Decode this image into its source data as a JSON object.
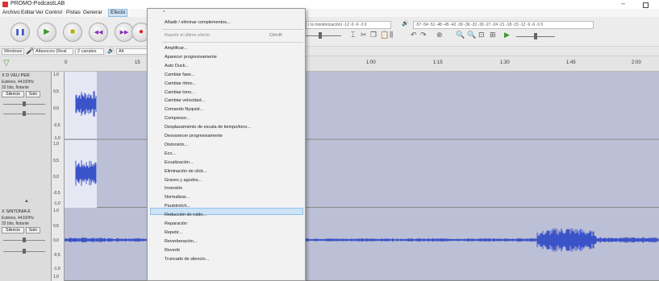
{
  "window": {
    "title": "PROMO-PodcastLAB",
    "min_glyph": "–"
  },
  "menubar": {
    "items": [
      "Archivo",
      "Editar",
      "Ver",
      "Control",
      "Pistas",
      "Generar",
      "Efecto"
    ]
  },
  "toolbar": {
    "pause_glyph": "❚❚",
    "play_glyph": "▶",
    "stop_glyph": "■",
    "skip_start_glyph": "◀◀",
    "skip_end_glyph": "▶▶",
    "record_glyph": "●",
    "monitor_ruler": "r la monitorización) -12 -9 -6 -3 0",
    "playback_ruler": "-57 -54 -51 -48 -45 -42 -39 -36 -33 -30 -27 -24 -21 -18 -15 -12 -9 -6 -3 0",
    "speaker_glyph": "🔊"
  },
  "devicebar": {
    "host": "Windows",
    "input": "Altavoces (Real",
    "channels": "2 canales",
    "output": "Alt"
  },
  "timeline": {
    "ticks": [
      "0",
      "15",
      "1:00",
      "1:15",
      "1:30",
      "1:45",
      "2:00"
    ]
  },
  "tracks": [
    {
      "name": "X  D VEU PER",
      "info1": "Estéreo, 44100Hz",
      "info2": "32 bits, flotante",
      "mute_label": "Silencio",
      "solo_label": "Solo",
      "scale": [
        "1,0",
        "0,5",
        "0,0",
        "-0,5",
        "-1,0",
        "1,0",
        "0,5",
        "0,0",
        "-0,5",
        "-1,0"
      ]
    },
    {
      "name": "X  SINTONIA E",
      "info1": "Estéreo, 44100Hz",
      "info2": "32 bits, flotante",
      "mute_label": "Silencio",
      "solo_label": "Solo",
      "scale": [
        "1,0",
        "0,5",
        "0,0",
        "-0,5",
        "-1,0",
        "1,0"
      ]
    }
  ],
  "effect_menu": {
    "top_arrow": "^",
    "add_remove": "Añadir / eliminar complementos...",
    "repeat_last": "Repetir el último efecto",
    "repeat_shortcut": "Ctrl+R",
    "items": [
      "Amplificar...",
      "Aparecer progresivamente",
      "Auto Duck...",
      "Cambiar fase...",
      "Cambiar ritmo...",
      "Cambiar tono...",
      "Cambiar velocidad...",
      "Comando Nyquist...",
      "Compresor...",
      "Desplazamiento de escala de tiempo/tono...",
      "Desvanecer progresivamente",
      "Distorsión...",
      "Eco...",
      "Ecualización...",
      "Eliminación de click...",
      "Graves y agudos...",
      "Inversión",
      "Normalizar...",
      "Paulstretch...",
      "Reducción de ruido...",
      "Reparación",
      "Repetir...",
      "Reverberación...",
      "Revertir",
      "Truncado de silencio..."
    ],
    "highlighted": "Normalizar..."
  },
  "colors": {
    "wave_blue": "#3b53c8",
    "wave_bg": "#bcc0d6",
    "highlight": "#cde4f7"
  }
}
